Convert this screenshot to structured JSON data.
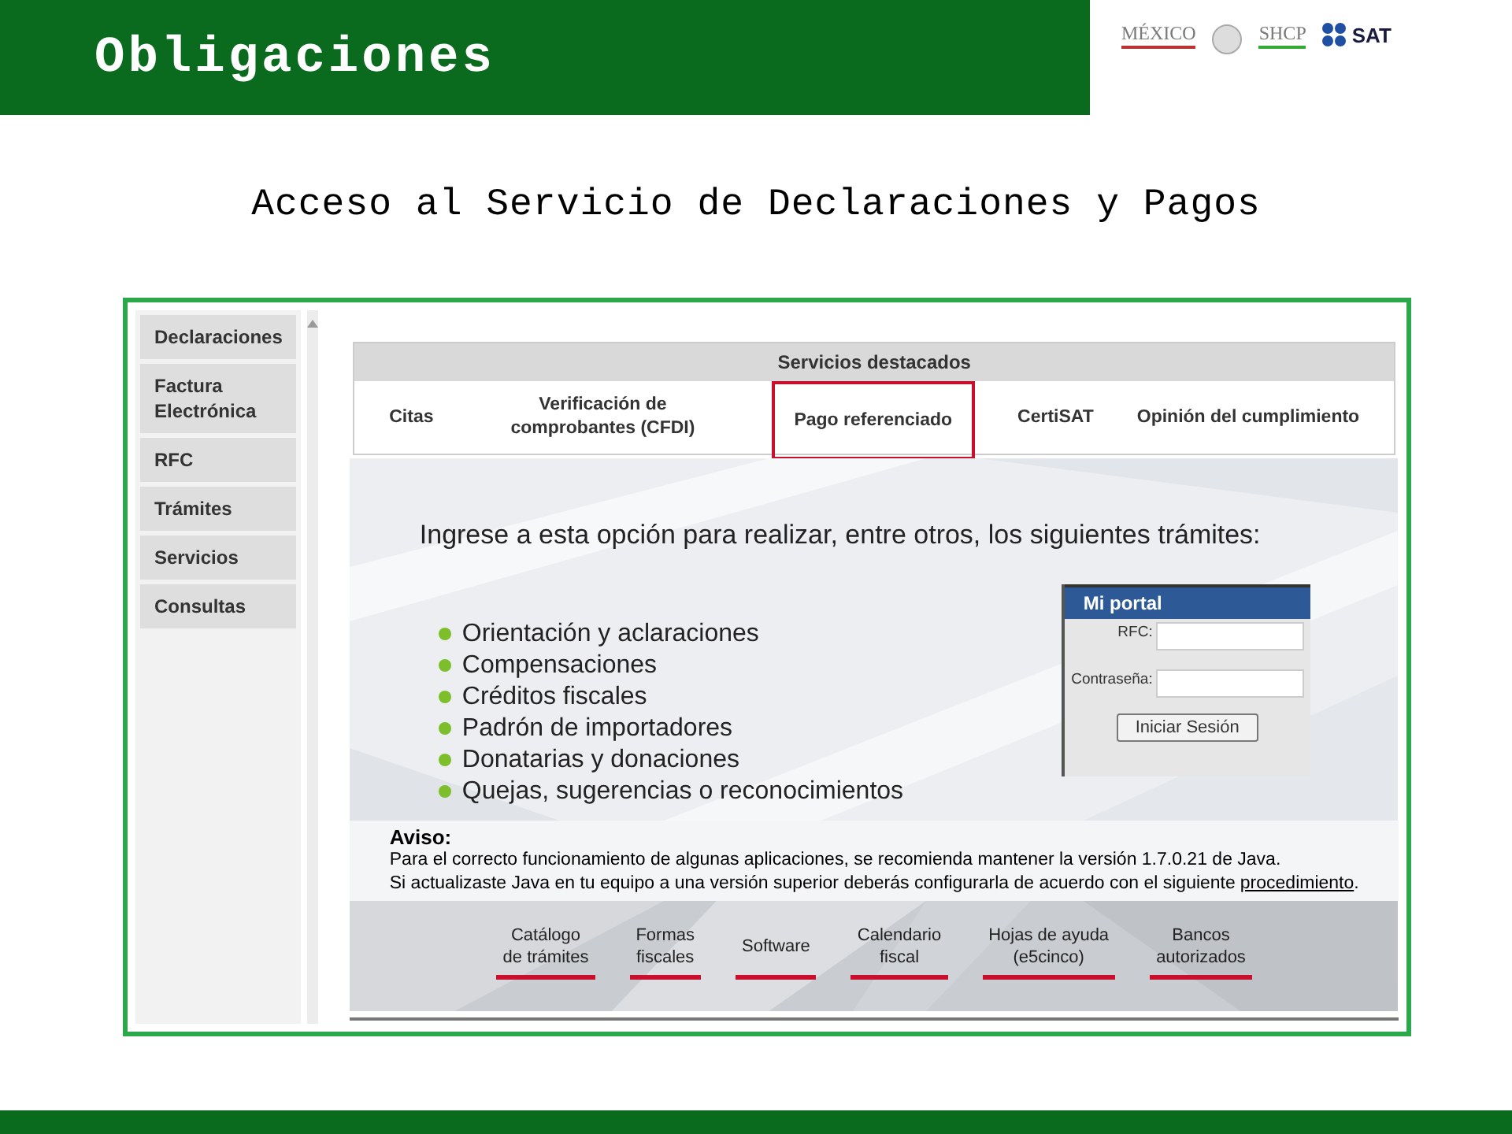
{
  "slide_title": "Obligaciones",
  "logos": {
    "mexico": "MÉXICO",
    "shcp": "SHCP",
    "sat": "SAT"
  },
  "subtitle": "Acceso al Servicio de Declaraciones y Pagos",
  "sidebar": {
    "items": [
      {
        "label": "Declaraciones"
      },
      {
        "label": "Factura Electrónica"
      },
      {
        "label": "RFC"
      },
      {
        "label": "Trámites"
      },
      {
        "label": "Servicios"
      },
      {
        "label": "Consultas"
      }
    ]
  },
  "featured": {
    "title": "Servicios destacados",
    "items": [
      {
        "label": "Citas",
        "highlighted": false
      },
      {
        "label": "Verificación de comprobantes (CFDI)",
        "highlighted": false
      },
      {
        "label": "Pago referenciado",
        "highlighted": true
      },
      {
        "label": "CertiSAT",
        "highlighted": false
      },
      {
        "label": "Opinión del cumplimiento",
        "highlighted": false
      }
    ]
  },
  "intro": "Ingrese a esta opción para realizar, entre otros, los siguientes trámites:",
  "procedures": [
    "Orientación y aclaraciones",
    "Compensaciones",
    "Créditos fiscales",
    "Padrón de importadores",
    "Donatarias y donaciones",
    "Quejas, sugerencias o reconocimientos"
  ],
  "login": {
    "title": "Mi portal",
    "fields": [
      {
        "label": "RFC:"
      },
      {
        "label": "Contraseña:"
      }
    ],
    "button": "Iniciar Sesión"
  },
  "notice": {
    "title": "Aviso:",
    "line_1": "Para el correcto funcionamiento de algunas aplicaciones, se recomienda mantener la versión 1.7.0.21 de Java.",
    "line_2": "Si actualizaste Java en tu equipo a una versión superior deberás configurarla de acuerdo con el siguiente",
    "link": "procedimiento",
    "line_2_end": "."
  },
  "bottom_links": [
    [
      "Catálogo",
      "de trámites"
    ],
    [
      "Formas",
      "fiscales"
    ],
    [
      "Software"
    ],
    [
      "Calendario",
      "fiscal"
    ],
    [
      "Hojas de ayuda",
      "(e5cinco)"
    ],
    [
      "Bancos",
      "autorizados"
    ]
  ]
}
